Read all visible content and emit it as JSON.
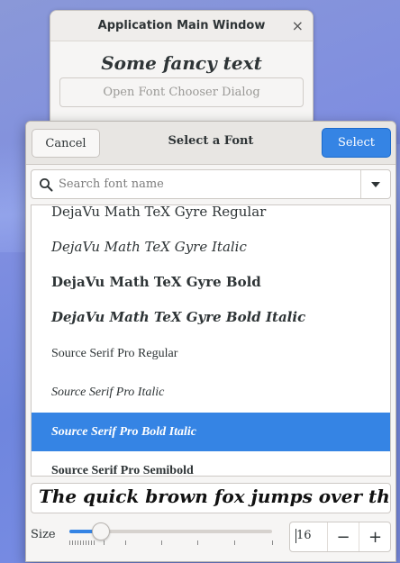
{
  "main_window": {
    "title": "Application Main Window",
    "close_glyph": "×",
    "sample_text": "Some fancy text",
    "open_button_label": "Open Font Chooser Dialog"
  },
  "dialog": {
    "title": "Select a Font",
    "cancel_label": "Cancel",
    "select_label": "Select",
    "search_placeholder": "Search font name",
    "search_value": "",
    "fonts": [
      {
        "label": "DejaVu Math TeX Gyre Regular",
        "selected": false
      },
      {
        "label": "DejaVu Math TeX Gyre Italic",
        "selected": false
      },
      {
        "label": "DejaVu Math TeX Gyre Bold",
        "selected": false
      },
      {
        "label": "DejaVu Math TeX Gyre Bold Italic",
        "selected": false
      },
      {
        "label": "Source Serif Pro Regular",
        "selected": false
      },
      {
        "label": "Source Serif Pro Italic",
        "selected": false
      },
      {
        "label": "Source Serif Pro Bold Italic",
        "selected": true
      },
      {
        "label": "Source Serif Pro Semibold",
        "selected": false
      }
    ],
    "preview_text": "The quick brown fox jumps over the laz",
    "size_label": "Size",
    "size_value": "16",
    "slider_fraction": 0.14
  },
  "colors": {
    "accent": "#3584e4",
    "window_bg": "#f6f5f4",
    "text": "#2e3436"
  },
  "icons": {
    "search": "search-icon",
    "dropdown": "chevron-down-icon",
    "close": "close-icon",
    "minus": "minus-icon",
    "plus": "plus-icon"
  }
}
